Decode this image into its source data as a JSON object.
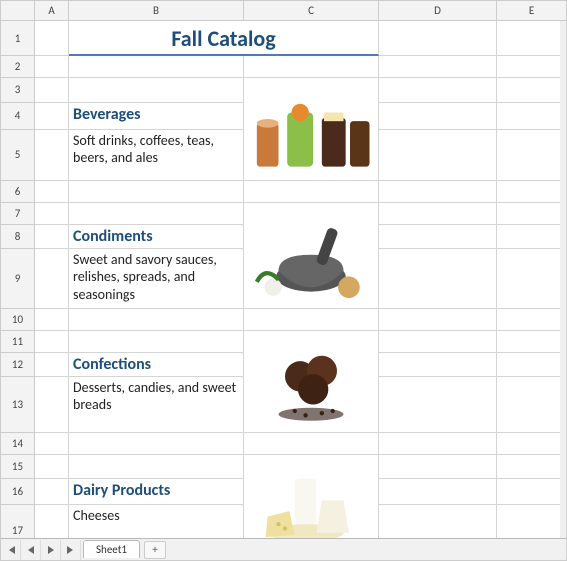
{
  "columns": [
    "A",
    "B",
    "C",
    "D",
    "E"
  ],
  "rows": [
    "1",
    "2",
    "3",
    "4",
    "5",
    "6",
    "7",
    "8",
    "9",
    "10",
    "11",
    "12",
    "13",
    "14",
    "15",
    "16",
    "17"
  ],
  "title": "Fall Catalog",
  "categories": [
    {
      "name": "Beverages",
      "description": "Soft drinks, coffees, teas, beers, and ales",
      "image": "beverages-image"
    },
    {
      "name": "Condiments",
      "description": "Sweet and savory sauces, relishes, spreads, and seasonings",
      "image": "condiments-image"
    },
    {
      "name": "Confections",
      "description": "Desserts, candies, and sweet breads",
      "image": "confections-image"
    },
    {
      "name": "Dairy Products",
      "description": "Cheeses",
      "image": "dairy-image"
    }
  ],
  "tabs": {
    "active": "Sheet1"
  },
  "nav": {
    "first": "⏮",
    "prev": "◀",
    "next": "▶",
    "last": "⏭",
    "add": "+"
  }
}
